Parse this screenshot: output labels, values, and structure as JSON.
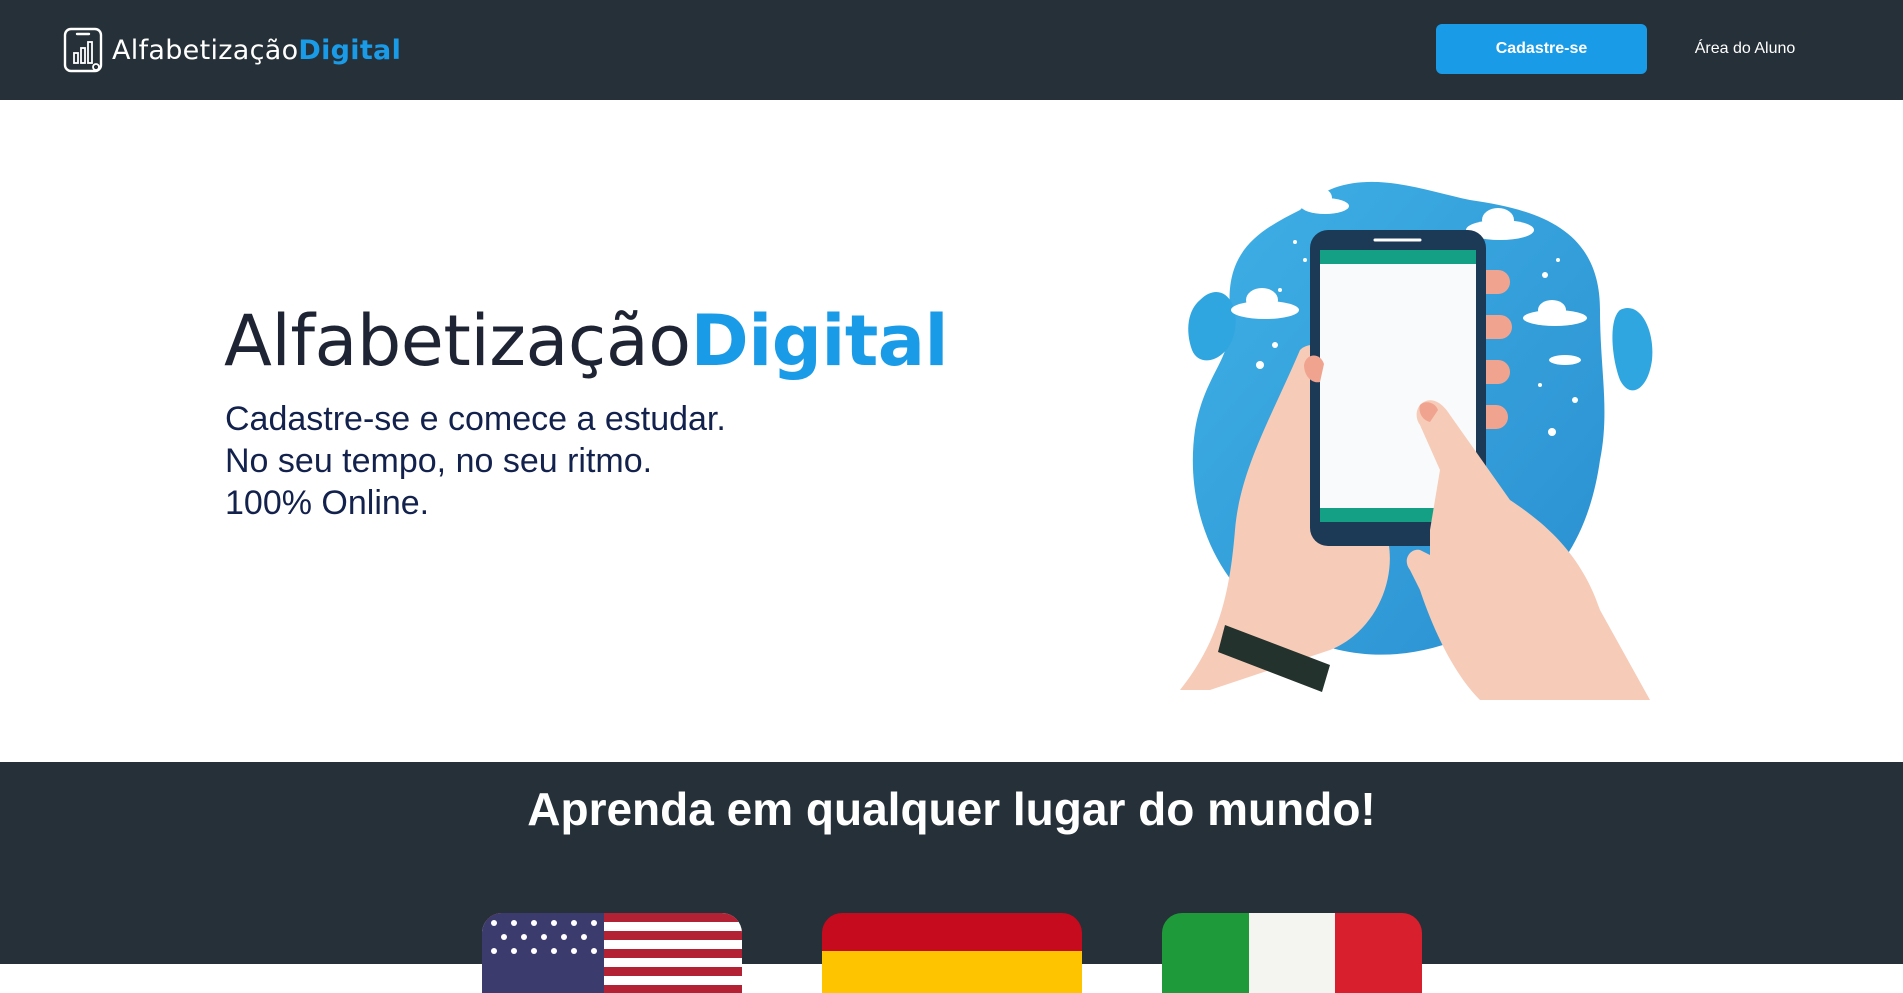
{
  "nav": {
    "brand": {
      "part1": "Alfabetização",
      "part2": "Digital",
      "icon": "phone-chart-icon"
    },
    "signup_label": "Cadastre-se",
    "student_area_label": "Área do Aluno"
  },
  "hero": {
    "title_part1": "Alfabetização",
    "title_part2": "Digital",
    "lines": [
      "Cadastre-se e comece a estudar.",
      "No seu tempo, no seu ritmo.",
      "100% Online."
    ],
    "illustration": "hands-holding-smartphone-illustration"
  },
  "languages": {
    "title": "Aprenda em qualquer lugar do mundo!",
    "flags": [
      {
        "name": "usa-flag-icon"
      },
      {
        "name": "spain-flag-icon"
      },
      {
        "name": "italy-flag-icon"
      }
    ]
  },
  "colors": {
    "nav_bg": "#263038",
    "accent": "#1a9be8",
    "hero_text": "#13214d"
  }
}
